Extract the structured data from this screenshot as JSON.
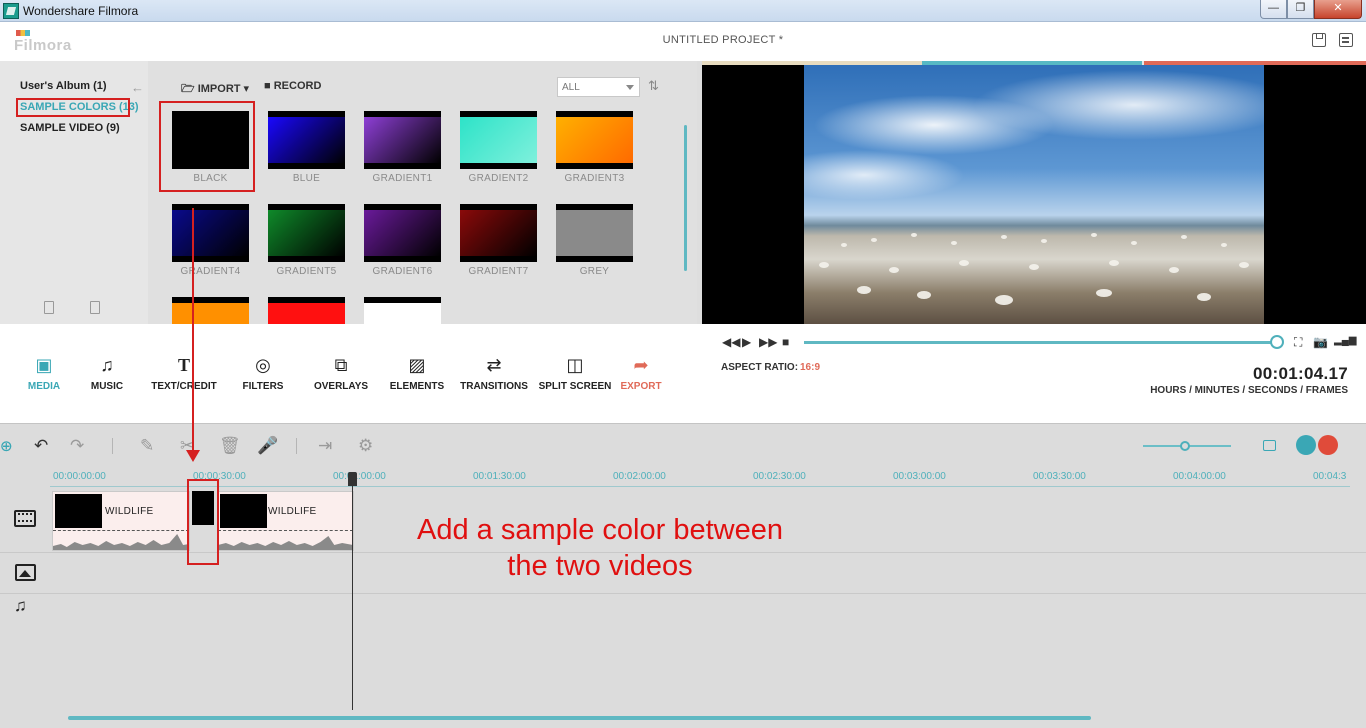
{
  "window": {
    "title": "Wondershare Filmora",
    "min": "—",
    "max": "❐",
    "close": "✕"
  },
  "header": {
    "logo": "Filmora",
    "project_title": "UNTITLED PROJECT *"
  },
  "album": {
    "items": [
      {
        "label": "User's Album (1)"
      },
      {
        "label": "SAMPLE COLORS (13)"
      },
      {
        "label": "SAMPLE VIDEO (9)"
      }
    ],
    "back": "←"
  },
  "library": {
    "import_label": "IMPORT",
    "record_label": "RECORD",
    "filter_value": "ALL",
    "items": [
      {
        "label": "BLACK",
        "color": "#000000"
      },
      {
        "label": "BLUE",
        "color": "#1a08ff"
      },
      {
        "label": "GRADIENT1",
        "color": "#8e3fd6"
      },
      {
        "label": "GRADIENT2",
        "color": "#2de3c8"
      },
      {
        "label": "GRADIENT3",
        "color": "#ffb000"
      },
      {
        "label": "GRADIENT4",
        "color": "#0a0a8c"
      },
      {
        "label": "GRADIENT5",
        "color": "#0f8a2a"
      },
      {
        "label": "GRADIENT6",
        "color": "#6a1a9a"
      },
      {
        "label": "GRADIENT7",
        "color": "#8a0a0a"
      },
      {
        "label": "GREY",
        "color": "#8a8a8a"
      },
      {
        "label": "",
        "color": "#ff9000"
      },
      {
        "label": "",
        "color": "#ff1010"
      },
      {
        "label": "",
        "color": "#ffffff"
      }
    ]
  },
  "preview": {
    "aspect_label": "ASPECT RATIO:",
    "aspect_value": "16:9",
    "timecode": "00:01:04.17",
    "timecode_units": "HOURS / MINUTES / SECONDS / FRAMES"
  },
  "categories": [
    {
      "label": "MEDIA",
      "icon": "media-icon"
    },
    {
      "label": "MUSIC",
      "icon": "music-icon"
    },
    {
      "label": "TEXT/CREDIT",
      "icon": "text-icon"
    },
    {
      "label": "FILTERS",
      "icon": "filters-icon"
    },
    {
      "label": "OVERLAYS",
      "icon": "overlays-icon"
    },
    {
      "label": "ELEMENTS",
      "icon": "elements-icon"
    },
    {
      "label": "TRANSITIONS",
      "icon": "transitions-icon"
    },
    {
      "label": "SPLIT SCREEN",
      "icon": "split-screen-icon"
    },
    {
      "label": "EXPORT",
      "icon": "export-icon"
    }
  ],
  "timeline": {
    "ruler": [
      "00:00:00:00",
      "00:00:30:00",
      "00:01:00:00",
      "00:01:30:00",
      "00:02:00:00",
      "00:02:30:00",
      "00:03:00:00",
      "00:03:30:00",
      "00:04:00:00",
      "00:04:3"
    ],
    "clips": [
      {
        "label": "WILDLIFE"
      },
      {
        "label": "WILDLIFE"
      }
    ],
    "annotation": "Add a sample color between the two videos"
  },
  "colors": {
    "accent": "#3aa7b5",
    "highlight": "#d52020",
    "export": "#e06a58"
  }
}
